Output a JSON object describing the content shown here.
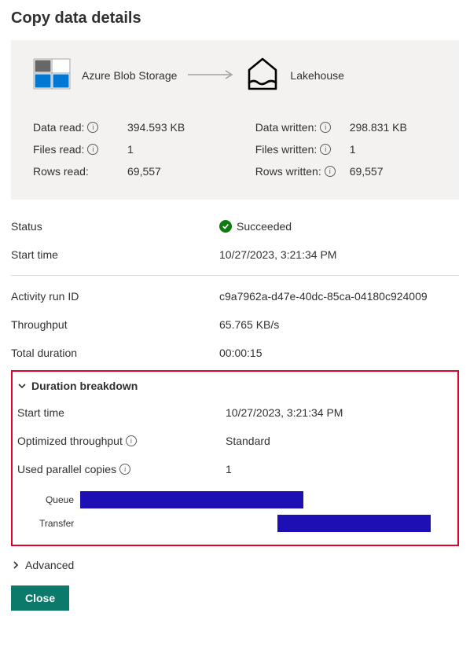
{
  "title": "Copy data details",
  "flow": {
    "source_label": "Azure Blob Storage",
    "target_label": "Lakehouse"
  },
  "metrics_left": {
    "data_read_label": "Data read:",
    "data_read_value": "394.593 KB",
    "files_read_label": "Files read:",
    "files_read_value": "1",
    "rows_read_label": "Rows read:",
    "rows_read_value": "69,557"
  },
  "metrics_right": {
    "data_written_label": "Data written:",
    "data_written_value": "298.831 KB",
    "files_written_label": "Files written:",
    "files_written_value": "1",
    "rows_written_label": "Rows written:",
    "rows_written_value": "69,557"
  },
  "status": {
    "label": "Status",
    "value": "Succeeded"
  },
  "start_time": {
    "label": "Start time",
    "value": "10/27/2023, 3:21:34 PM"
  },
  "run_id": {
    "label": "Activity run ID",
    "value": "c9a7962a-d47e-40dc-85ca-04180c924009"
  },
  "throughput": {
    "label": "Throughput",
    "value": "65.765 KB/s"
  },
  "total_duration": {
    "label": "Total duration",
    "value": "00:00:15"
  },
  "breakdown": {
    "header": "Duration breakdown",
    "start_time_label": "Start time",
    "start_time_value": "10/27/2023, 3:21:34 PM",
    "opt_throughput_label": "Optimized throughput",
    "opt_throughput_value": "Standard",
    "parallel_copies_label": "Used parallel copies",
    "parallel_copies_value": "1"
  },
  "chart_data": {
    "type": "bar",
    "orientation": "horizontal",
    "bars": [
      {
        "name": "Queue",
        "start_pct": 0,
        "width_pct": 60
      },
      {
        "name": "Transfer",
        "start_pct": 53,
        "width_pct": 41
      }
    ],
    "color": "#1e0fb4"
  },
  "advanced_label": "Advanced",
  "close_label": "Close"
}
